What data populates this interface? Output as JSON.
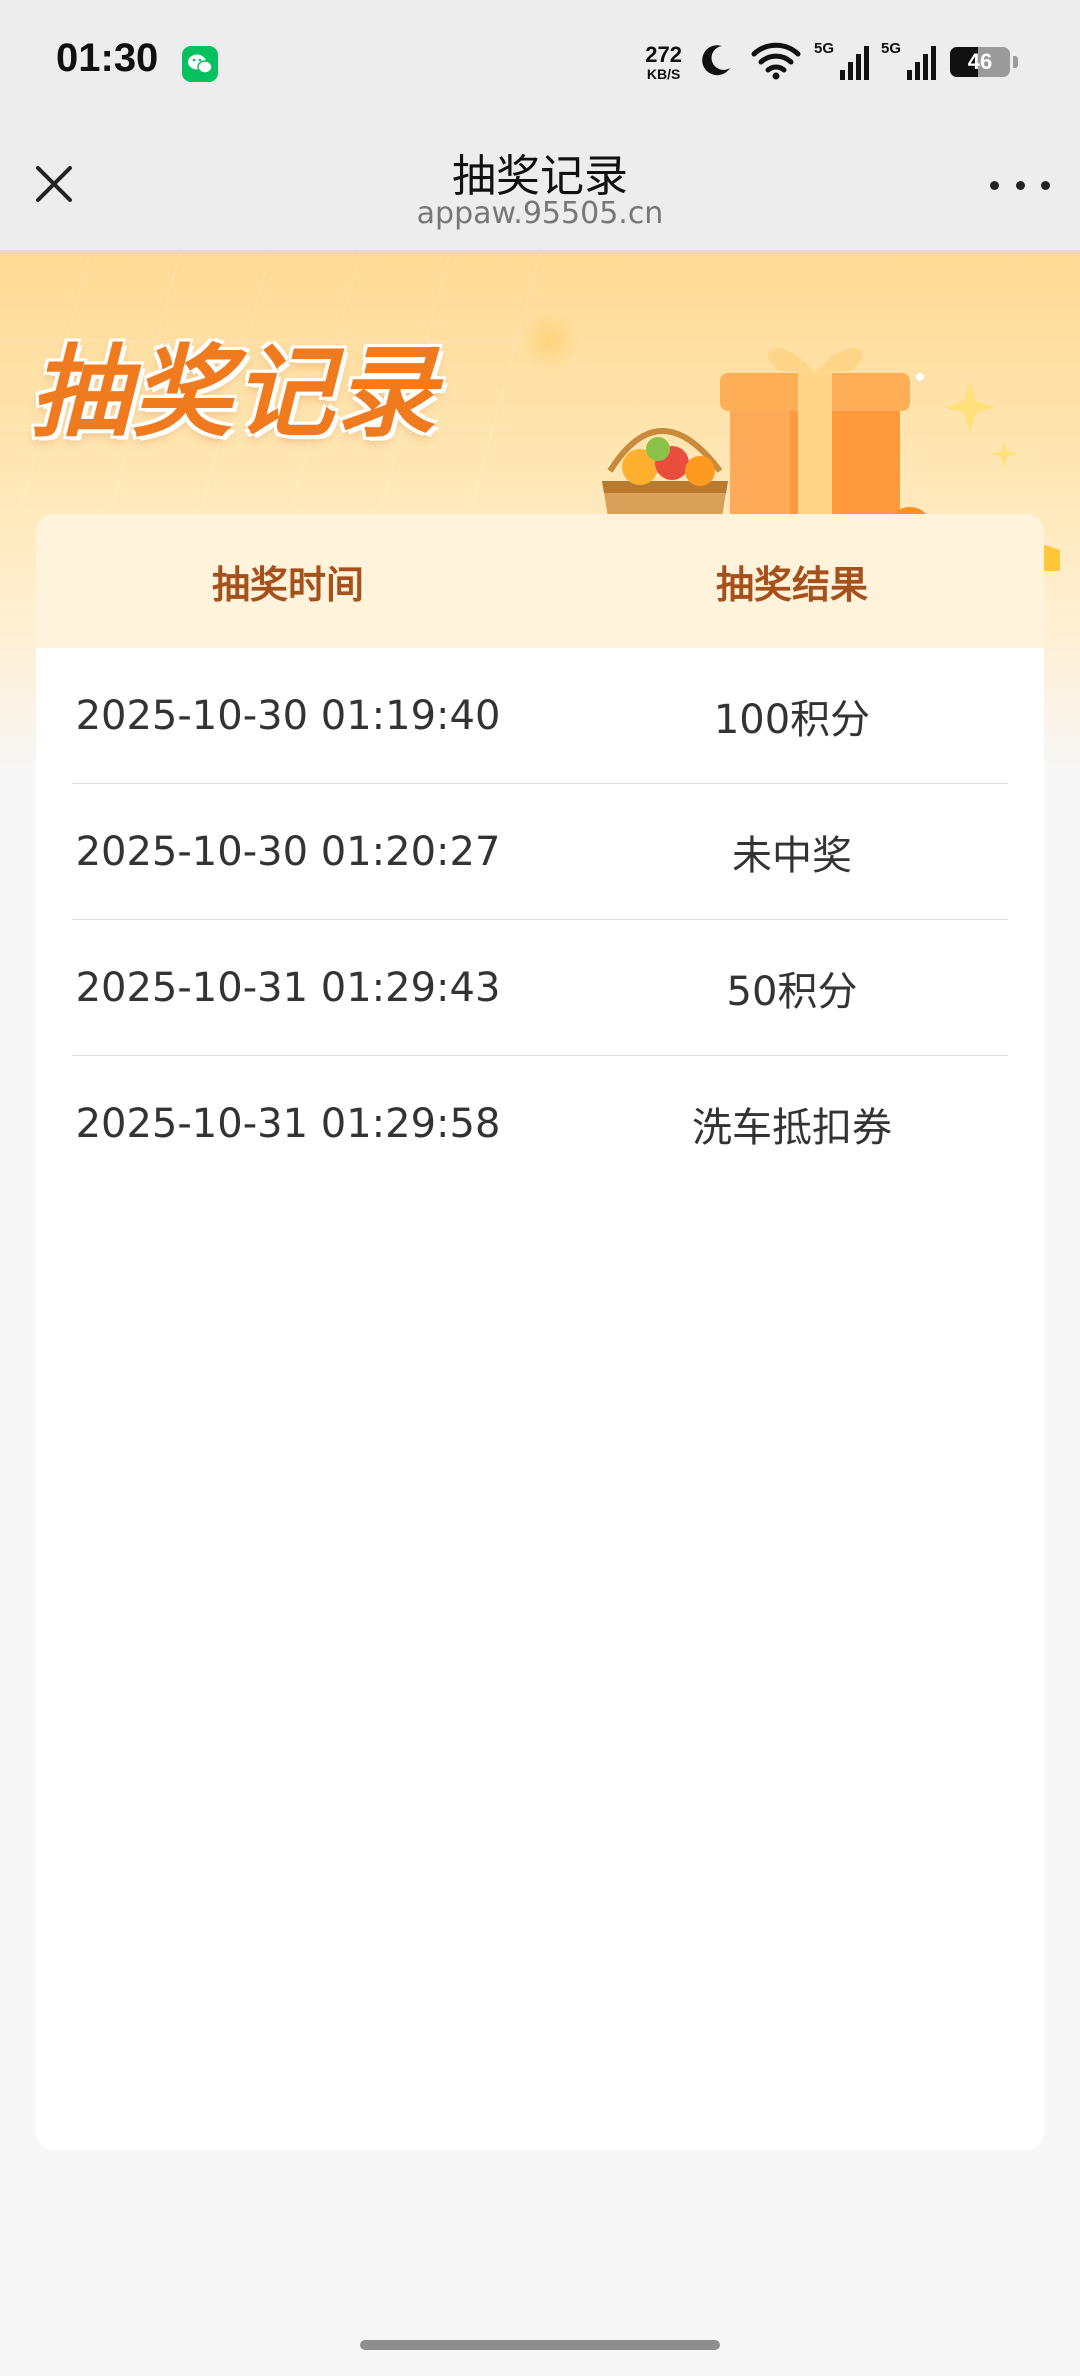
{
  "status_bar": {
    "time": "01:30",
    "net_speed_value": "272",
    "net_speed_unit": "KB/S",
    "signal1_label": "5G",
    "signal2_label": "5G",
    "battery_level": "46"
  },
  "nav": {
    "title": "抽奖记录",
    "url": "appaw.95505.cn"
  },
  "banner": {
    "title": "抽奖记录"
  },
  "table": {
    "headers": [
      "抽奖时间",
      "抽奖结果"
    ],
    "rows": [
      {
        "time": "2025-10-30 01:19:40",
        "result": "100积分"
      },
      {
        "time": "2025-10-30 01:20:27",
        "result": "未中奖"
      },
      {
        "time": "2025-10-31 01:29:43",
        "result": "50积分"
      },
      {
        "time": "2025-10-31 01:29:58",
        "result": "洗车抵扣券"
      }
    ]
  },
  "colors": {
    "accent": "#f07a1e",
    "header_text": "#a6501b",
    "header_bg": "#fff3dc",
    "wechat_green": "#07c160"
  }
}
